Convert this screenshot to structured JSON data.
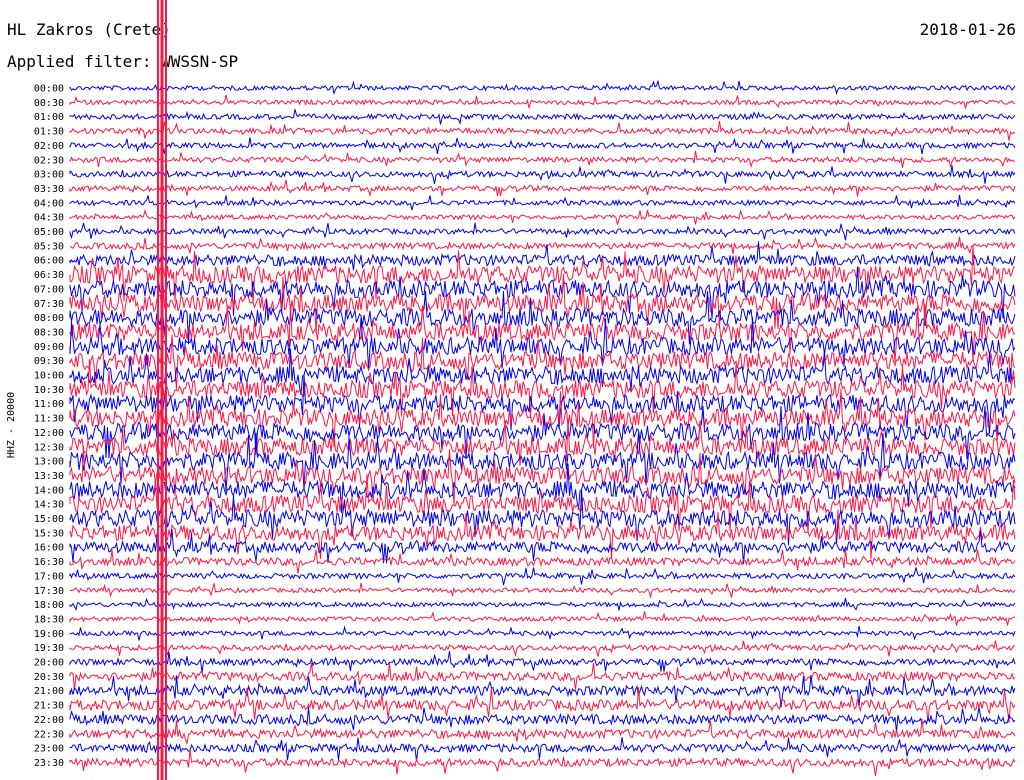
{
  "station": "HL Zakros (Crete)",
  "date": "2018-01-26",
  "filter_text": "Applied filter: WWSSN-SP",
  "colors": {
    "trace_a": "#0000ee",
    "trace_b": "#ff1744"
  },
  "chart_data": {
    "type": "line",
    "title": "HL Zakros (Crete)",
    "ylabel": "HHZ - 20000",
    "xlabel": "",
    "grid": false,
    "series": [
      {
        "name": "",
        "values": []
      }
    ],
    "row_labels": [
      "00:00",
      "00:30",
      "01:00",
      "01:30",
      "02:00",
      "02:30",
      "03:00",
      "03:30",
      "04:00",
      "04:30",
      "05:00",
      "05:30",
      "06:00",
      "06:30",
      "07:00",
      "07:30",
      "08:00",
      "08:30",
      "09:00",
      "09:30",
      "10:00",
      "10:30",
      "11:00",
      "11:30",
      "12:00",
      "12:30",
      "13:00",
      "13:30",
      "14:00",
      "14:30",
      "15:00",
      "15:30",
      "16:00",
      "16:30",
      "17:00",
      "17:30",
      "18:00",
      "18:30",
      "19:00",
      "19:30",
      "20:00",
      "20:30",
      "21:00",
      "21:30",
      "22:00",
      "22:30",
      "23:00",
      "23:30"
    ],
    "row_activity": [
      1,
      1,
      1.2,
      1.3,
      1.2,
      1.2,
      1.3,
      1.2,
      1.1,
      1,
      1.2,
      1.4,
      2.5,
      4,
      4,
      4,
      4,
      4,
      4,
      4,
      4,
      4,
      4,
      4,
      4,
      4,
      4,
      4,
      4,
      4,
      4,
      3.5,
      2.5,
      1.8,
      1.2,
      1,
      1,
      1,
      1,
      1.2,
      1.5,
      2,
      2.2,
      2.4,
      2.2,
      2,
      1.8,
      1.8
    ]
  }
}
